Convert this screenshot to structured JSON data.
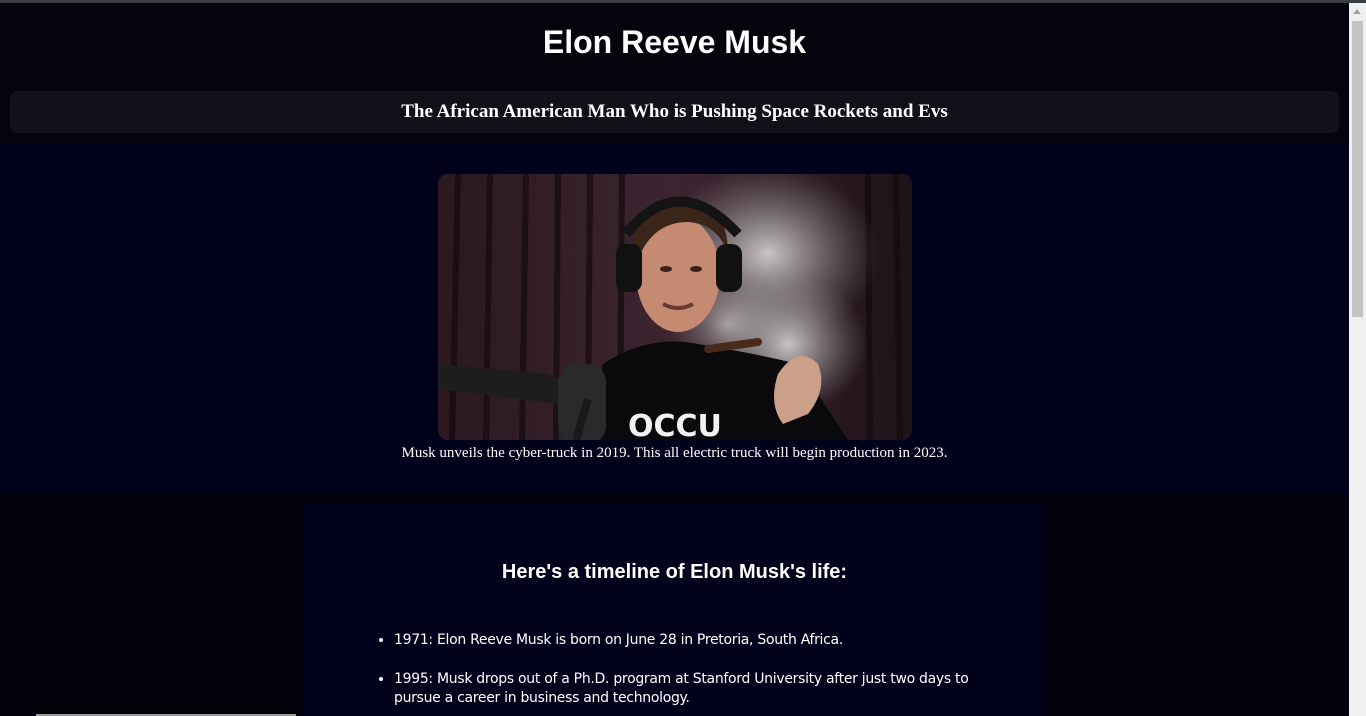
{
  "header": {
    "title": "Elon Reeve Musk",
    "subtitle": "The African American Man Who is Pushing Space Rockets and Evs"
  },
  "figure": {
    "image_alt": "Elon Musk at a podcast microphone with headphones, holding a smoking cigar",
    "caption": "Musk unveils the cyber-truck in 2019. This all electric truck will begin production in 2023.",
    "shirt_text": "OCCU"
  },
  "timeline": {
    "heading": "Here's a timeline of Elon Musk's life:",
    "items": [
      "1971: Elon Reeve Musk is born on June 28 in Pretoria, South Africa.",
      "1995: Musk drops out of a Ph.D. program at Stanford University after just two days to pursue a career in business and technology."
    ]
  },
  "colors": {
    "page_bg": "#02030a",
    "band_bg": "#01011b",
    "subtitle_bg": "#111219"
  }
}
